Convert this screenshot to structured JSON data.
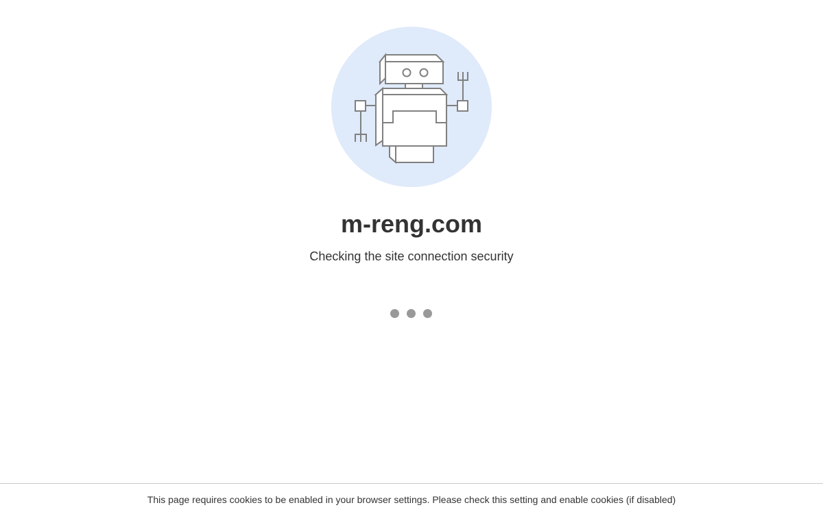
{
  "site": {
    "domain": "m-reng.com",
    "status_text": "Checking the site connection security"
  },
  "loader": {
    "dot_count": 3
  },
  "footer": {
    "cookie_notice": "This page requires cookies to be enabled in your browser settings. Please check this setting and enable cookies (if disabled)"
  },
  "colors": {
    "background": "#ffffff",
    "robot_circle": "#dfeafa",
    "robot_stroke": "#808080",
    "text": "#333333",
    "loader_dot": "#999999"
  },
  "icons": {
    "illustration": "robot-icon"
  }
}
